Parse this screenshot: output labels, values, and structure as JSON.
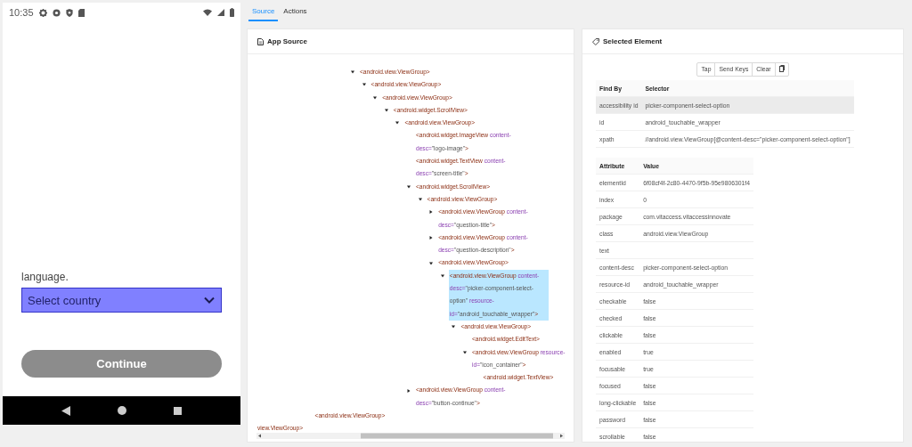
{
  "phone": {
    "status_bar": {
      "time": "10:35"
    },
    "prompt_text": "language.",
    "country_select": {
      "placeholder": "Select country"
    },
    "continue_button": {
      "label": "Continue",
      "disabled": true
    }
  },
  "tabs": [
    {
      "label": "Source",
      "selected": true
    },
    {
      "label": "Actions",
      "selected": false
    }
  ],
  "source_panel": {
    "title": "App Source",
    "tree": [
      {
        "children": [
          {
            "children": [
              {
                "children": [
                  {
                    "children": [
                      {
                        "children": [
                          {
                            "parts": [
                              {
                                "kind": "tag",
                                "text": "<android.view.ViewGroup>"
                              }
                            ],
                            "expanded": true,
                            "selected": false,
                            "children": [
                              {
                                "parts": [
                                  {
                                    "kind": "tag",
                                    "text": "<android.view.ViewGroup>"
                                  }
                                ],
                                "expanded": true,
                                "selected": false,
                                "children": [
                                  {
                                    "parts": [
                                      {
                                        "kind": "tag",
                                        "text": "<android.view.ViewGroup>"
                                      }
                                    ],
                                    "expanded": true,
                                    "selected": false,
                                    "children": [
                                      {
                                        "parts": [
                                          {
                                            "kind": "tag",
                                            "text": "<android.widget.ScrollView>"
                                          }
                                        ],
                                        "expanded": true,
                                        "selected": false,
                                        "children": [
                                          {
                                            "parts": [
                                              {
                                                "kind": "tag",
                                                "text": "<android.view.ViewGroup>"
                                              }
                                            ],
                                            "expanded": true,
                                            "selected": false,
                                            "children": [
                                              {
                                                "parts": [
                                                  {
                                                    "kind": "tag",
                                                    "text": "<android.widget.ImageView"
                                                  },
                                                  {
                                                    "kind": "attr",
                                                    "text": " content-desc="
                                                  },
                                                  {
                                                    "kind": "value",
                                                    "text": "\"logo-image\""
                                                  },
                                                  {
                                                    "kind": "tag",
                                                    "text": ">"
                                                  }
                                                ],
                                                "selected": false
                                              },
                                              {
                                                "parts": [
                                                  {
                                                    "kind": "tag",
                                                    "text": "<android.widget.TextView"
                                                  },
                                                  {
                                                    "kind": "attr",
                                                    "text": " content-desc="
                                                  },
                                                  {
                                                    "kind": "value",
                                                    "text": "\"screen-title\""
                                                  },
                                                  {
                                                    "kind": "tag",
                                                    "text": ">"
                                                  }
                                                ],
                                                "selected": false
                                              },
                                              {
                                                "parts": [
                                                  {
                                                    "kind": "tag",
                                                    "text": "<android.widget.ScrollView>"
                                                  }
                                                ],
                                                "expanded": true,
                                                "selected": false,
                                                "children": [
                                                  {
                                                    "parts": [
                                                      {
                                                        "kind": "tag",
                                                        "text": "<android.view.ViewGroup>"
                                                      }
                                                    ],
                                                    "expanded": true,
                                                    "selected": false,
                                                    "children": [
                                                      {
                                                        "parts": [
                                                          {
                                                            "kind": "tag",
                                                            "text": "<android.view.ViewGroup"
                                                          },
                                                          {
                                                            "kind": "attr",
                                                            "text": " content-desc="
                                                          },
                                                          {
                                                            "kind": "value",
                                                            "text": "\"question-title\""
                                                          },
                                                          {
                                                            "kind": "tag",
                                                            "text": ">"
                                                          }
                                                        ],
                                                        "expanded": false,
                                                        "selected": false
                                                      },
                                                      {
                                                        "parts": [
                                                          {
                                                            "kind": "tag",
                                                            "text": "<android.view.ViewGroup"
                                                          },
                                                          {
                                                            "kind": "attr",
                                                            "text": " content-desc="
                                                          },
                                                          {
                                                            "kind": "value",
                                                            "text": "\"question-description\""
                                                          },
                                                          {
                                                            "kind": "tag",
                                                            "text": ">"
                                                          }
                                                        ],
                                                        "expanded": false,
                                                        "selected": false
                                                      },
                                                      {
                                                        "parts": [
                                                          {
                                                            "kind": "tag",
                                                            "text": "<android.view.ViewGroup>"
                                                          }
                                                        ],
                                                        "expanded": true,
                                                        "selected": false,
                                                        "children": [
                                                          {
                                                            "parts": [
                                                              {
                                                                "kind": "tag",
                                                                "text": "<android.view.ViewGroup"
                                                              },
                                                              {
                                                                "kind": "attr",
                                                                "text": " content-desc="
                                                              },
                                                              {
                                                                "kind": "value",
                                                                "text": "\"picker-component-select-option\""
                                                              },
                                                              {
                                                                "kind": "attr",
                                                                "text": " resource-id="
                                                              },
                                                              {
                                                                "kind": "value",
                                                                "text": "\"android_touchable_wrapper\""
                                                              },
                                                              {
                                                                "kind": "tag",
                                                                "text": ">"
                                                              }
                                                            ],
                                                            "expanded": true,
                                                            "selected": true,
                                                            "children": [
                                                              {
                                                                "parts": [
                                                                  {
                                                                    "kind": "tag",
                                                                    "text": "<android.view.ViewGroup>"
                                                                  }
                                                                ],
                                                                "expanded": true,
                                                                "selected": false,
                                                                "children": [
                                                                  {
                                                                    "parts": [
                                                                      {
                                                                        "kind": "tag",
                                                                        "text": "<android.widget.EditText>"
                                                                      }
                                                                    ],
                                                                    "selected": false
                                                                  },
                                                                  {
                                                                    "parts": [
                                                                      {
                                                                        "kind": "tag",
                                                                        "text": "<android.view.ViewGroup"
                                                                      },
                                                                      {
                                                                        "kind": "attr",
                                                                        "text": " resource-id="
                                                                      },
                                                                      {
                                                                        "kind": "value",
                                                                        "text": "\"icon_container\""
                                                                      },
                                                                      {
                                                                        "kind": "tag",
                                                                        "text": ">"
                                                                      }
                                                                    ],
                                                                    "expanded": true,
                                                                    "selected": false,
                                                                    "children": [
                                                                      {
                                                                        "parts": [
                                                                          {
                                                                            "kind": "tag",
                                                                            "text": "<android.widget.TextView>"
                                                                          }
                                                                        ],
                                                                        "selected": false
                                                                      }
                                                                    ]
                                                                  }
                                                                ]
                                                              }
                                                            ]
                                                          }
                                                        ]
                                                      }
                                                    ]
                                                  }
                                                ]
                                              },
                                              {
                                                "parts": [
                                                  {
                                                    "kind": "tag",
                                                    "text": "<android.view.ViewGroup"
                                                  },
                                                  {
                                                    "kind": "attr",
                                                    "text": " content-desc="
                                                  },
                                                  {
                                                    "kind": "value",
                                                    "text": "\"button-continue\""
                                                  },
                                                  {
                                                    "kind": "tag",
                                                    "text": ">"
                                                  }
                                                ],
                                                "expanded": false,
                                                "selected": false
                                              }
                                            ]
                                          }
                                        ]
                                      }
                                    ]
                                  }
                                ]
                              }
                            ]
                          }
                        ]
                      }
                    ]
                  }
                ]
              }
            ]
          },
          {
            "parts": [
              {
                "kind": "tag",
                "text": "<android.view.ViewGroup>"
              }
            ],
            "selected": false
          }
        ]
      },
      {
        "kind": "clipped",
        "parts": [
          {
            "kind": "tag",
            "text": "view.ViewGroup>"
          }
        ],
        "selected": false
      }
    ]
  },
  "element_panel": {
    "title": "Selected Element",
    "actions": [
      "Tap",
      "Send Keys",
      "Clear"
    ],
    "selector_table": {
      "columns": [
        "Find By",
        "Selector"
      ],
      "rows": [
        {
          "find_by": "accessibility id",
          "selector": "picker-component-select-option",
          "hovered": true
        },
        {
          "find_by": "id",
          "selector": "android_touchable_wrapper",
          "hovered": false
        },
        {
          "find_by": "xpath",
          "selector": "//android.view.ViewGroup[@content-desc=\"picker-component-select-option\"]",
          "hovered": false
        }
      ]
    },
    "attribute_table": {
      "columns": [
        "Attribute",
        "Value"
      ],
      "rows": [
        {
          "name": "elementId",
          "value": "6f08cf4f-2c80-4470-9f5b-95e9806301f4"
        },
        {
          "name": "index",
          "value": "0"
        },
        {
          "name": "package",
          "value": "com.vitaccess.vitaccessinnovate"
        },
        {
          "name": "class",
          "value": "android.view.ViewGroup"
        },
        {
          "name": "text"
        },
        {
          "name": "content-desc",
          "value": "picker-component-select-option"
        },
        {
          "name": "resource-id",
          "value": "android_touchable_wrapper"
        },
        {
          "name": "checkable",
          "value": "false"
        },
        {
          "name": "checked",
          "value": "false"
        },
        {
          "name": "clickable",
          "value": "false"
        },
        {
          "name": "enabled",
          "value": "true"
        },
        {
          "name": "focusable",
          "value": "true"
        },
        {
          "name": "focused",
          "value": "false"
        },
        {
          "name": "long-clickable",
          "value": "false"
        },
        {
          "name": "password",
          "value": "false"
        },
        {
          "name": "scrollable",
          "value": "false"
        }
      ]
    }
  }
}
